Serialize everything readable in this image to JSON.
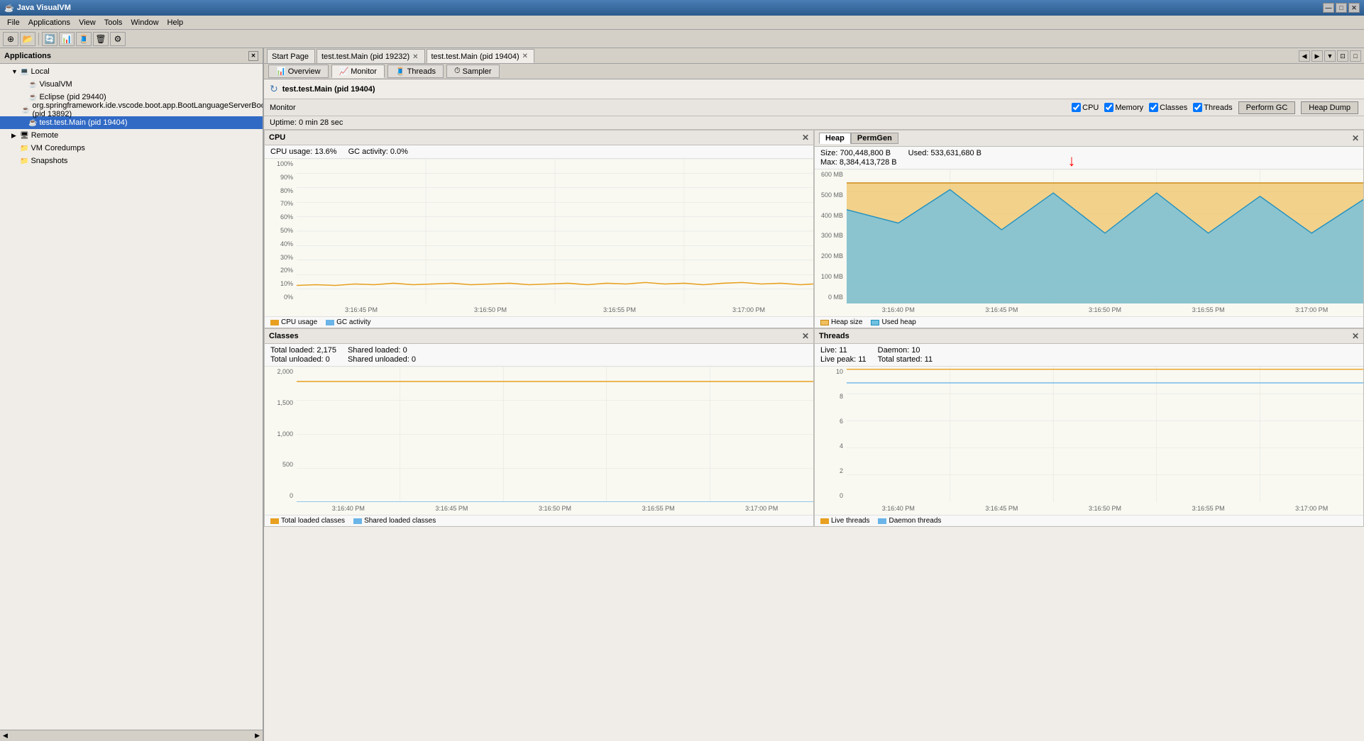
{
  "app": {
    "title": "Java VisualVM",
    "icon": "☕"
  },
  "titlebar": {
    "title": "Java VisualVM",
    "minimize": "—",
    "maximize": "□",
    "close": "✕"
  },
  "menubar": {
    "items": [
      "File",
      "Applications",
      "View",
      "Tools",
      "Window",
      "Help"
    ]
  },
  "leftPanel": {
    "title": "Applications",
    "closeBtn": "✕",
    "tree": [
      {
        "label": "Local",
        "indent": 1,
        "expander": "▼",
        "icon": "💻",
        "type": "folder"
      },
      {
        "label": "VisualVM",
        "indent": 2,
        "expander": "",
        "icon": "☕",
        "type": "app"
      },
      {
        "label": "Eclipse (pid 29440)",
        "indent": 2,
        "expander": "",
        "icon": "☕",
        "type": "app"
      },
      {
        "label": "org.springframework.ide.vscode.boot.app.BootLanguageServerBootApp (pid 13892)",
        "indent": 2,
        "expander": "",
        "icon": "☕",
        "type": "app"
      },
      {
        "label": "test.test.Main (pid 19404)",
        "indent": 2,
        "expander": "",
        "icon": "☕",
        "type": "app",
        "selected": true
      },
      {
        "label": "Remote",
        "indent": 1,
        "expander": "▶",
        "icon": "🖥",
        "type": "folder"
      },
      {
        "label": "VM Coredumps",
        "indent": 1,
        "expander": "",
        "icon": "📁",
        "type": "folder"
      },
      {
        "label": "Snapshots",
        "indent": 1,
        "expander": "",
        "icon": "📁",
        "type": "folder"
      }
    ]
  },
  "tabs": [
    {
      "label": "Start Page",
      "closeable": false
    },
    {
      "label": "test.test.Main (pid 19232)",
      "closeable": true
    },
    {
      "label": "test.test.Main (pid 19404)",
      "closeable": true,
      "active": true
    }
  ],
  "monitorTabs": [
    {
      "label": "Overview",
      "icon": "📊"
    },
    {
      "label": "Monitor",
      "icon": "📈",
      "active": true
    },
    {
      "label": "Threads",
      "icon": "🧵"
    },
    {
      "label": "Sampler",
      "icon": "⏱"
    }
  ],
  "pageTitle": "test.test.Main (pid 19404)",
  "monitorHeader": {
    "label": "Monitor",
    "checkboxes": [
      "CPU",
      "Memory",
      "Classes",
      "Threads"
    ],
    "gcBtn": "Perform GC",
    "heapBtn": "Heap Dump"
  },
  "uptime": "Uptime: 0 min 28 sec",
  "cpuChart": {
    "title": "CPU",
    "cpuUsage": "CPU usage: 13.6%",
    "gcActivity": "GC activity: 0.0%",
    "yLabels": [
      "100%",
      "90%",
      "80%",
      "70%",
      "60%",
      "50%",
      "40%",
      "30%",
      "20%",
      "10%",
      "0%"
    ],
    "xLabels": [
      "3:16:45 PM",
      "3:16:50 PM",
      "3:16:55 PM",
      "3:17:00 PM"
    ],
    "legend": [
      "CPU usage",
      "GC activity"
    ]
  },
  "heapChart": {
    "tabs": [
      "Heap",
      "PermGen"
    ],
    "activeTab": "Heap",
    "size": "Size: 700,448,800 B",
    "max": "Max: 8,384,413,728 B",
    "used": "Used: 533,631,680 B",
    "yLabels": [
      "600 MB",
      "500 MB",
      "400 MB",
      "300 MB",
      "200 MB",
      "100 MB",
      "0 MB"
    ],
    "xLabels": [
      "3:16:40 PM",
      "3:16:45 PM",
      "3:16:50 PM",
      "3:16:55 PM",
      "3:17:00 PM"
    ],
    "legend": [
      "Heap size",
      "Used heap"
    ]
  },
  "classesChart": {
    "title": "Classes",
    "totalLoaded": "Total loaded: 2,175",
    "totalUnloaded": "Total unloaded: 0",
    "sharedLoaded": "Shared loaded: 0",
    "sharedUnloaded": "Shared unloaded: 0",
    "yLabels": [
      "2,000",
      "1,500",
      "1,000",
      "500",
      "0"
    ],
    "xLabels": [
      "3:16:40 PM",
      "3:16:45 PM",
      "3:16:50 PM",
      "3:16:55 PM",
      "3:17:00 PM"
    ],
    "legend": [
      "Total loaded classes",
      "Shared loaded classes"
    ]
  },
  "threadsChart": {
    "title": "Threads",
    "live": "Live: 11",
    "livePeak": "Live peak: 11",
    "daemon": "Daemon: 10",
    "totalStarted": "Total started: 11",
    "yLabels": [
      "10",
      "8",
      "6",
      "4",
      "2",
      "0"
    ],
    "xLabels": [
      "3:16:40 PM",
      "3:16:45 PM",
      "3:16:50 PM",
      "3:16:55 PM",
      "3:17:00 PM"
    ],
    "legend": [
      "Live threads",
      "Daemon threads"
    ]
  }
}
